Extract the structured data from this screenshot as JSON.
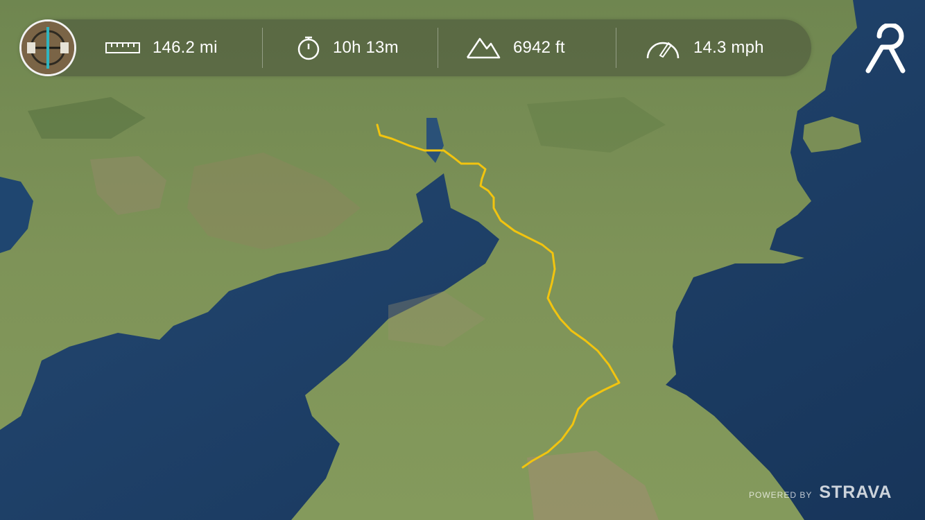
{
  "stats": {
    "distance": {
      "value": "146.2 mi",
      "icon": "ruler-icon"
    },
    "time": {
      "value": "10h 13m",
      "icon": "stopwatch-icon"
    },
    "elevation": {
      "value": "6942 ft",
      "icon": "mountains-icon"
    },
    "speed": {
      "value": "14.3 mph",
      "icon": "speedometer-icon"
    }
  },
  "attribution": {
    "powered_by": "POWERED BY",
    "brand": "STRAVA"
  },
  "colors": {
    "route": "#f2c40f",
    "sea": "#1f3d63",
    "land": "#7d8f55",
    "stats_bar": "rgba(72,82,58,0.55)",
    "text": "#ffffff"
  }
}
